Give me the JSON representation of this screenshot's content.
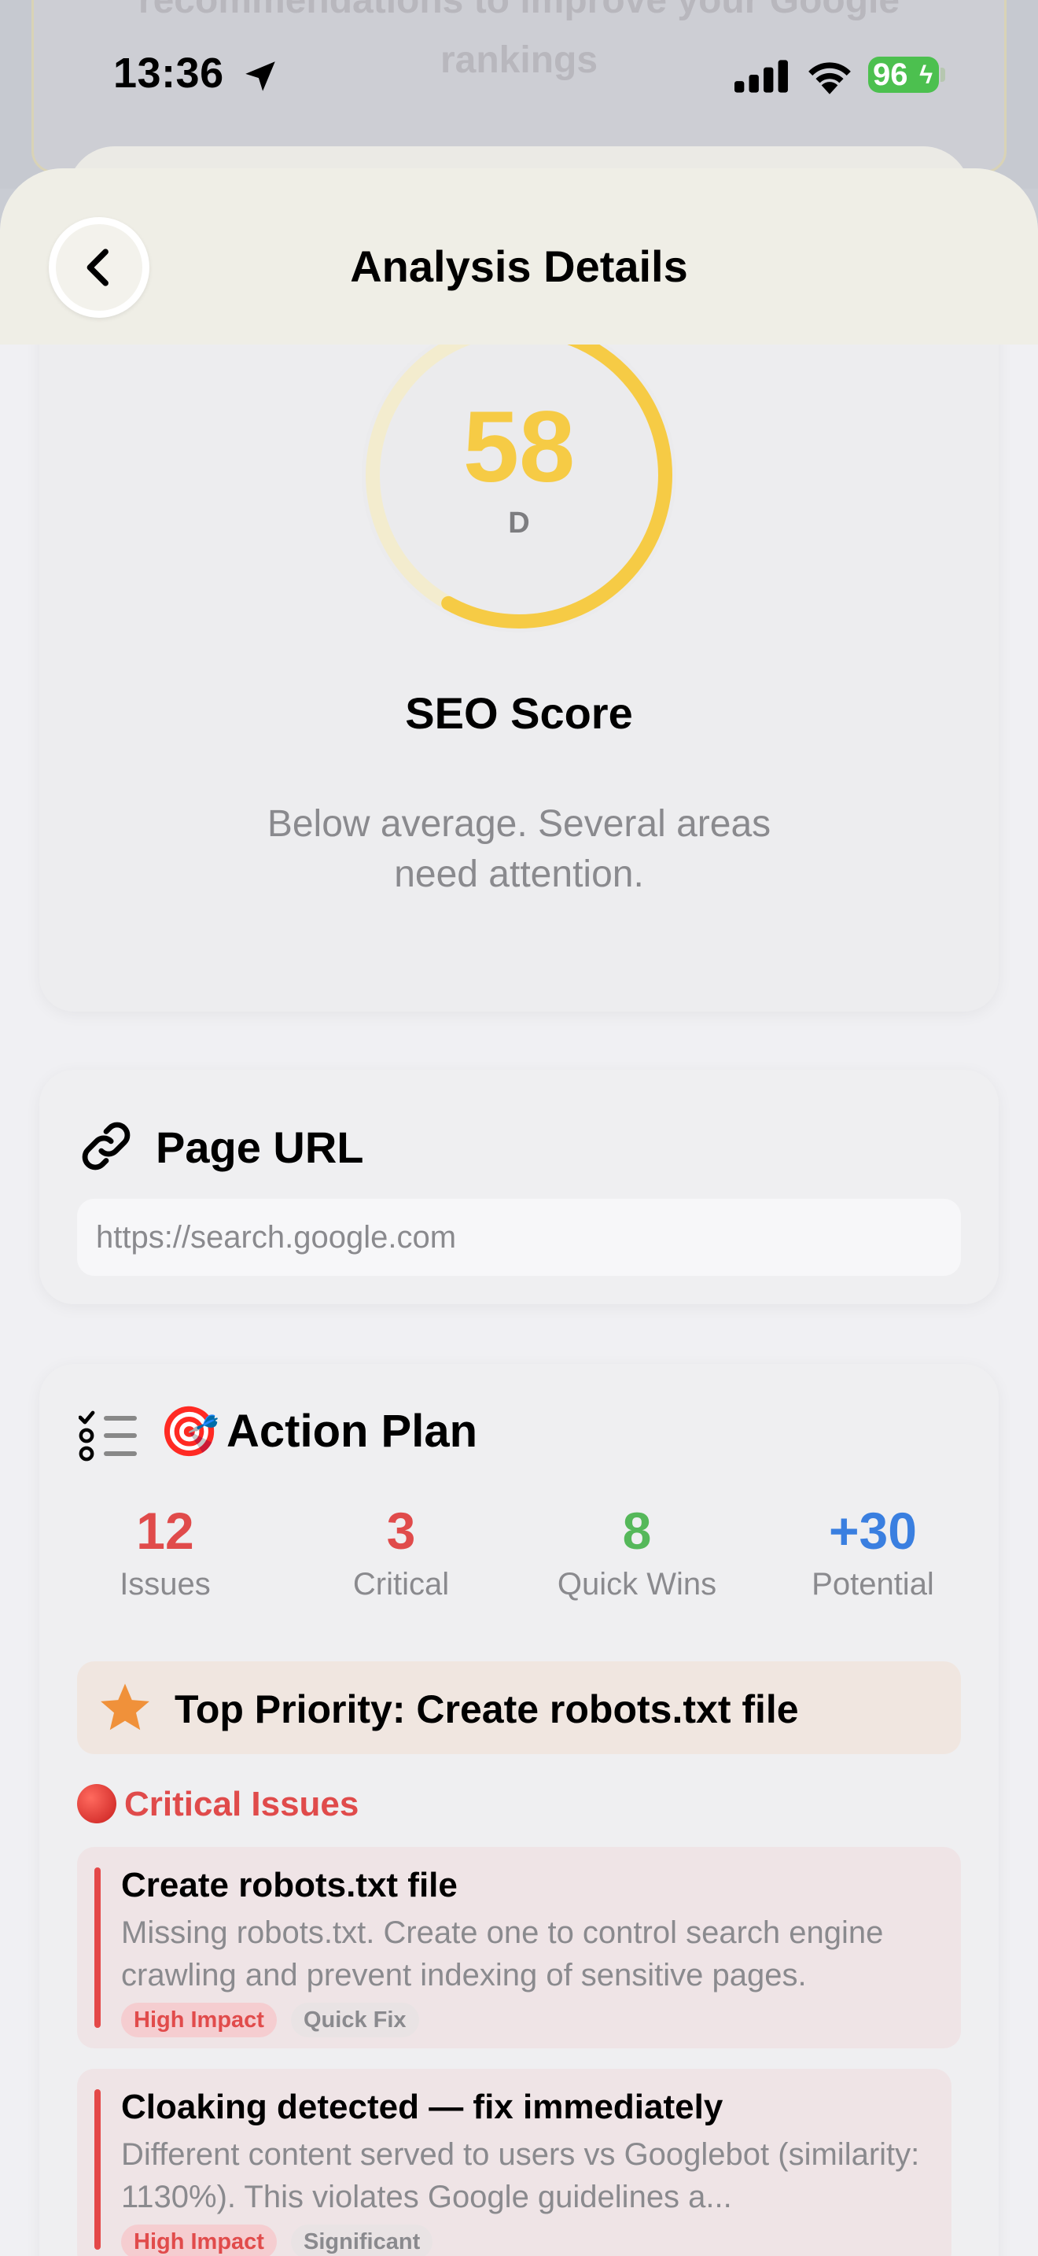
{
  "background_page": {
    "text_line1": "recommendations to improve your Google",
    "text_line2": "rankings"
  },
  "status_bar": {
    "time": "13:36",
    "battery": "96"
  },
  "nav": {
    "title": "Analysis Details",
    "back_icon": "chevron-left-icon"
  },
  "score": {
    "value": "58",
    "grade": "D",
    "fraction": 0.58,
    "title": "SEO Score",
    "description": "Below average. Several areas need attention.",
    "color": "#f6cb45"
  },
  "page_url": {
    "title": "Page URL",
    "value": "https://search.google.com",
    "icon": "link-icon"
  },
  "action_plan": {
    "title": "Action Plan",
    "emoji": "🎯",
    "stats": [
      {
        "value": "12",
        "label": "Issues",
        "color": "#e04b4b"
      },
      {
        "value": "3",
        "label": "Critical",
        "color": "#e04b4b"
      },
      {
        "value": "8",
        "label": "Quick Wins",
        "color": "#55b85a"
      },
      {
        "value": "+30",
        "label": "Potential",
        "color": "#3a7fe0"
      }
    ],
    "top_priority": "Top Priority: Create robots.txt file",
    "critical_heading": "Critical Issues",
    "issues": [
      {
        "title": "Create robots.txt file",
        "description": "Missing robots.txt. Create one to control search engine crawling and prevent indexing of sensitive pages.",
        "impact": "High Impact",
        "effort": "Quick Fix"
      },
      {
        "title": "Cloaking detected — fix immediately",
        "description": "Different content served to users vs Googlebot (similarity: 1130%). This violates Google guidelines a...",
        "impact": "High Impact",
        "effort": "Significant"
      }
    ]
  }
}
